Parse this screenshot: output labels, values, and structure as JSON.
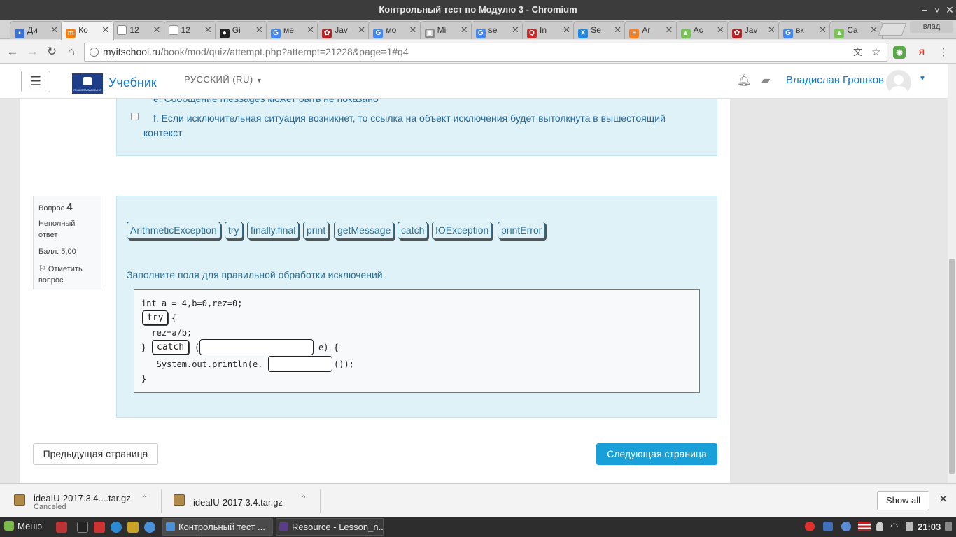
{
  "window": {
    "title": "Контрольный тест по Модулю 3 - Chromium"
  },
  "tabs": [
    {
      "label": "Ди",
      "color": "#3b6fd1",
      "glyph": "▪"
    },
    {
      "label": "Ко",
      "color": "#f98012",
      "glyph": "m",
      "active": true
    },
    {
      "label": "12",
      "color": "#ffffff",
      "glyph": ""
    },
    {
      "label": "12",
      "color": "#ffffff",
      "glyph": ""
    },
    {
      "label": "Gi",
      "color": "#222222",
      "glyph": "●"
    },
    {
      "label": "ме",
      "color": "#4285f4",
      "glyph": "G"
    },
    {
      "label": "Jav",
      "color": "#b22222",
      "glyph": "✿"
    },
    {
      "label": "мо",
      "color": "#4285f4",
      "glyph": "G"
    },
    {
      "label": "Mi",
      "color": "#888888",
      "glyph": "▣"
    },
    {
      "label": "se",
      "color": "#4285f4",
      "glyph": "G"
    },
    {
      "label": "In",
      "color": "#c62828",
      "glyph": "Q"
    },
    {
      "label": "Se",
      "color": "#1e88e5",
      "glyph": "✕"
    },
    {
      "label": "Ar",
      "color": "#f48024",
      "glyph": "≡"
    },
    {
      "label": "Ac",
      "color": "#78c257",
      "glyph": "▲"
    },
    {
      "label": "Jav",
      "color": "#b22222",
      "glyph": "✿"
    },
    {
      "label": "вк",
      "color": "#4285f4",
      "glyph": "G"
    },
    {
      "label": "Ca",
      "color": "#78c257",
      "glyph": "▲"
    }
  ],
  "profile": {
    "label": "влад"
  },
  "url": {
    "host": "myitschool.ru",
    "path": "/book/mod/quiz/attempt.php?attempt=21228&page=1#q4"
  },
  "site": {
    "menu_icon": "☰",
    "brand": "Учебник",
    "logo_text": "IT ШКОЛА SAMSUNG",
    "language": "РУССКИЙ (RU)",
    "user": "Владислав Грошков"
  },
  "prev_question": {
    "option_e": "e. Сообщение messages может быть не показано",
    "option_f_line1": "f. Если исключительная ситуация возникнет, то ссылка на объект исключения будет вытолкнута в вышестоящий",
    "option_f_line2": "контекст"
  },
  "question": {
    "label": "Вопрос",
    "number": "4",
    "state": "Неполный ответ",
    "state_l1": "Неполный",
    "state_l2": "ответ",
    "grade": "Балл: 5,00",
    "flag_l1": "Отметить",
    "flag_l2": "вопрос",
    "choices": [
      "ArithmeticException",
      "try",
      "finally.final",
      "print",
      "getMessage",
      "catch",
      "IOException",
      "printError"
    ],
    "prompt": "Заполните поля для правильной обработки исключений.",
    "code": {
      "line1": "int a = 4,b=0,rez=0;",
      "line2_slot": "try",
      "line2_rest": "{",
      "line3": "  rez=a/b;",
      "line4_pre": "}",
      "line4_slot": "catch",
      "line4_paren": "(",
      "line4_rest": "e) {",
      "line5_pre": "   System.out.println(e.",
      "line5_rest": "());",
      "line6": "}"
    }
  },
  "nav": {
    "prev": "Предыдущая страница",
    "next": "Следующая страница"
  },
  "downloads": [
    {
      "name": "ideaIU-2017.3.4....tar.gz",
      "status": "Canceled"
    },
    {
      "name": "ideaIU-2017.3.4.tar.gz",
      "status": ""
    }
  ],
  "downloads_show_all": "Show all",
  "taskbar": {
    "menu": "Меню",
    "tasks": [
      "Контрольный тест ...",
      "Resource - Lesson_n..."
    ],
    "clock": "21:03"
  }
}
